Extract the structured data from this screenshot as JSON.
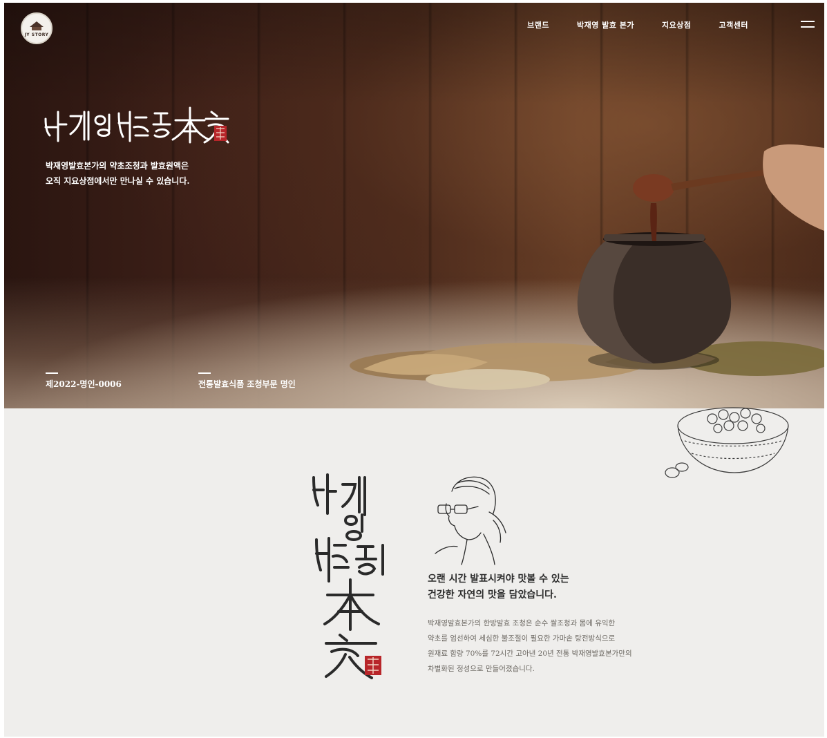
{
  "header": {
    "logo_text": "JY STORY",
    "nav": [
      "브랜드",
      "박재영 발효 본가",
      "지요상점",
      "고객센터"
    ],
    "menu_icon": "hamburger-icon"
  },
  "hero": {
    "brand_title": "박재영 발효本家",
    "description_lines": [
      "박재영발효본가의 약초조청과 발효원액은",
      "오직 지요상점에서만 만나실 수 있습니다."
    ],
    "badges": [
      "제2022-명인-0006",
      "전통발효식품 조청부문 명인"
    ]
  },
  "intro": {
    "calligraphy": "박재영발효本家",
    "headline_lines": [
      "오랜 시간 발표시켜야 맛볼 수 있는",
      "건강한 자연의 맛을 담았습니다."
    ],
    "body_lines": [
      "박재영발효본가의 한방발효 조청은 순수 쌀조청과 몸에 유익한",
      "약초를 엄선하여 세심한 불조절이 필요한 가마솥 탕전방식으로",
      "원재료 함량 70%를 72시간 고아낸 20년 전통 박재영발효본가만의",
      "차별화된 정성으로 만들어졌습니다."
    ]
  },
  "colors": {
    "hero_dark": "#3e2018",
    "seal_red": "#b8262a",
    "section_bg": "#efeeec",
    "headline": "#2b2b2b",
    "body": "#6c6862"
  }
}
